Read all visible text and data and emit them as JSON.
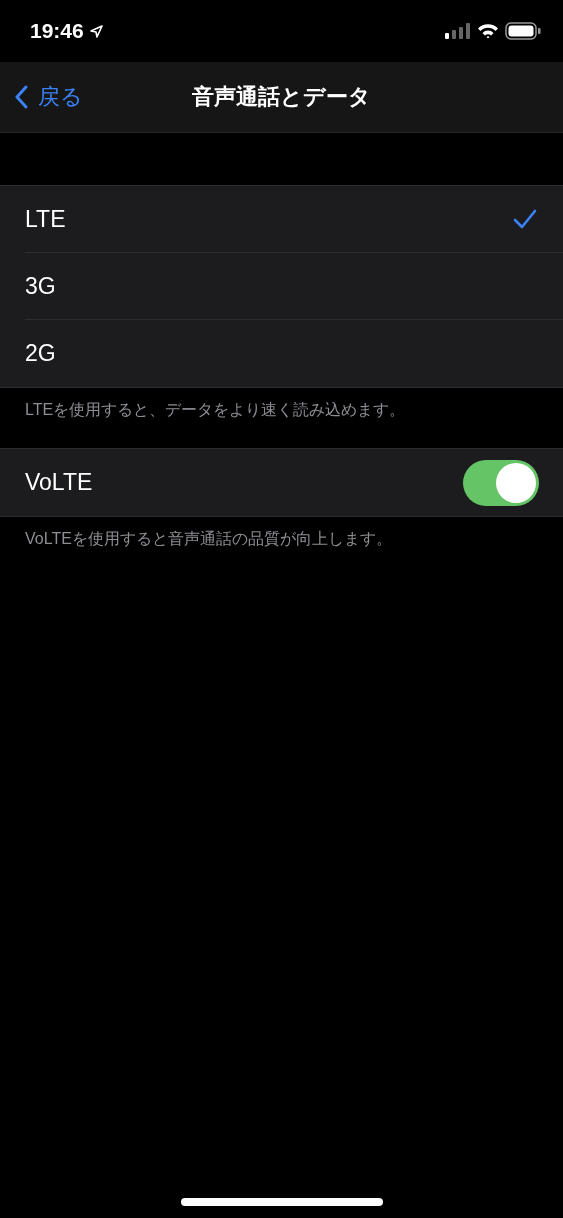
{
  "status_bar": {
    "time": "19:46"
  },
  "nav": {
    "back": "戻る",
    "title": "音声通話とデータ"
  },
  "network_options": [
    {
      "label": "LTE",
      "selected": true
    },
    {
      "label": "3G",
      "selected": false
    },
    {
      "label": "2G",
      "selected": false
    }
  ],
  "network_footer": "LTEを使用すると、データをより速く読み込めます。",
  "volte": {
    "label": "VoLTE",
    "on": true
  },
  "volte_footer": "VoLTEを使用すると音声通話の品質が向上します。"
}
